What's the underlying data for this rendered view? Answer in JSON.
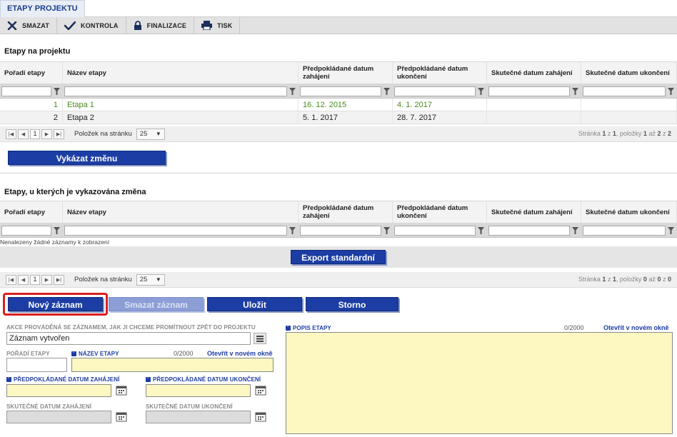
{
  "tab": "ETAPY PROJEKTU",
  "toolbar": {
    "delete": "SMAZAT",
    "check": "KONTROLA",
    "finalize": "FINALIZACE",
    "print": "TISK"
  },
  "grid1": {
    "title": "Etapy na projektu",
    "headers": [
      "Pořadí etapy",
      "Název etapy",
      "Předpokládané datum zahájení",
      "Předpokládané datum ukončení",
      "Skutečné datum zahájení",
      "Skutečné datum ukončení"
    ],
    "rows": [
      {
        "order": "1",
        "name": "Etapa 1",
        "start": "16. 12. 2015",
        "end": "4. 1. 2017",
        "real_start": "",
        "real_end": ""
      },
      {
        "order": "2",
        "name": "Etapa 2",
        "start": "5. 1. 2017",
        "end": "28. 7. 2017",
        "real_start": "",
        "real_end": ""
      }
    ],
    "pager": {
      "page": "1",
      "per_page_label": "Položek na stránku",
      "per_page": "25",
      "info_a": "Stránka ",
      "info_b": "1",
      "info_c": " z ",
      "info_d": "1",
      "info_e": ", položky ",
      "info_f": "1",
      "info_g": " až ",
      "info_h": "2",
      "info_i": " z ",
      "info_j": "2"
    }
  },
  "report_change": "Vykázat změnu",
  "grid2": {
    "title": "Etapy, u kterých je vykazována změna",
    "headers": [
      "Pořadí etapy",
      "Název etapy",
      "Předpokládané datum zahájení",
      "Předpokládané datum ukončení",
      "Skutečné datum zahájení",
      "Skutečné datum ukončení"
    ],
    "empty": "Nenalezeny žádné záznamy k zobrazení",
    "export": "Export standardní",
    "pager": {
      "page": "1",
      "per_page_label": "Položek na stránku",
      "per_page": "25",
      "info_a": "Stránka ",
      "info_b": "1",
      "info_c": " z ",
      "info_d": "1",
      "info_e": ", položky ",
      "info_f": "0",
      "info_g": " až ",
      "info_h": "0",
      "info_i": " z ",
      "info_j": "0"
    }
  },
  "actions": {
    "new": "Nový záznam",
    "delete": "Smazat záznam",
    "save": "Uložit",
    "cancel": "Storno"
  },
  "form": {
    "action_label": "AKCE PROVÁDĚNÁ SE ZÁZNAMEM, JAK JI CHCEME PROMÍTNOUT ZPĚT DO PROJEKTU",
    "action_value": "Záznam vytvořen",
    "order_label": "POŘADÍ ETAPY",
    "name_label": "NÁZEV ETAPY",
    "name_counter": "0/2000",
    "name_link": "Otevřít v novém okně",
    "planned_start_label": "PŘEDPOKLÁDANÉ DATUM ZAHÁJENÍ",
    "planned_end_label": "PŘEDPOKLÁDANÉ DATUM UKONČENÍ",
    "real_start_label": "SKUTEČNÉ DATUM ZAHÁJENÍ",
    "real_end_label": "SKUTEČNÉ DATUM UKONČENÍ",
    "desc_label": "POPIS ETAPY",
    "desc_counter": "0/2000",
    "desc_link": "Otevřít v novém okně"
  },
  "colors": {
    "primary": "#1c3da3",
    "highlight": "#d92020",
    "required_field": "#fdf8c1",
    "green_row": "#4a8a1e"
  }
}
